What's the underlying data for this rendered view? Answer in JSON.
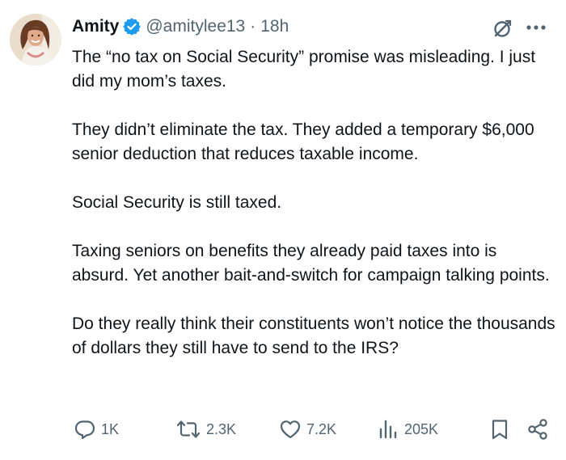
{
  "tweet": {
    "author": {
      "display_name": "Amity",
      "handle": "@amitylee13",
      "separator": "·",
      "time": "18h",
      "verified_icon": "verified-badge-icon",
      "avatar_icon": "avatar"
    },
    "paragraphs": [
      "The “no tax on Social Security” promise was misleading. I just did my mom’s taxes.",
      "They didn’t eliminate the tax. They added a temporary $6,000 senior deduction that reduces taxable income.",
      "Social Security is still taxed.",
      "Taxing seniors on benefits they already paid taxes into is absurd. Yet another bait-and-switch for campaign talking points.",
      "Do they really think their constituents won’t notice the thousands of dollars they still have to send to the IRS?"
    ],
    "actions": {
      "replies": "1K",
      "retweets": "2.3K",
      "likes": "7.2K",
      "views": "205K"
    }
  },
  "colors": {
    "text": "#0f1419",
    "secondary": "#536471",
    "verified": "#1d9bf0"
  }
}
